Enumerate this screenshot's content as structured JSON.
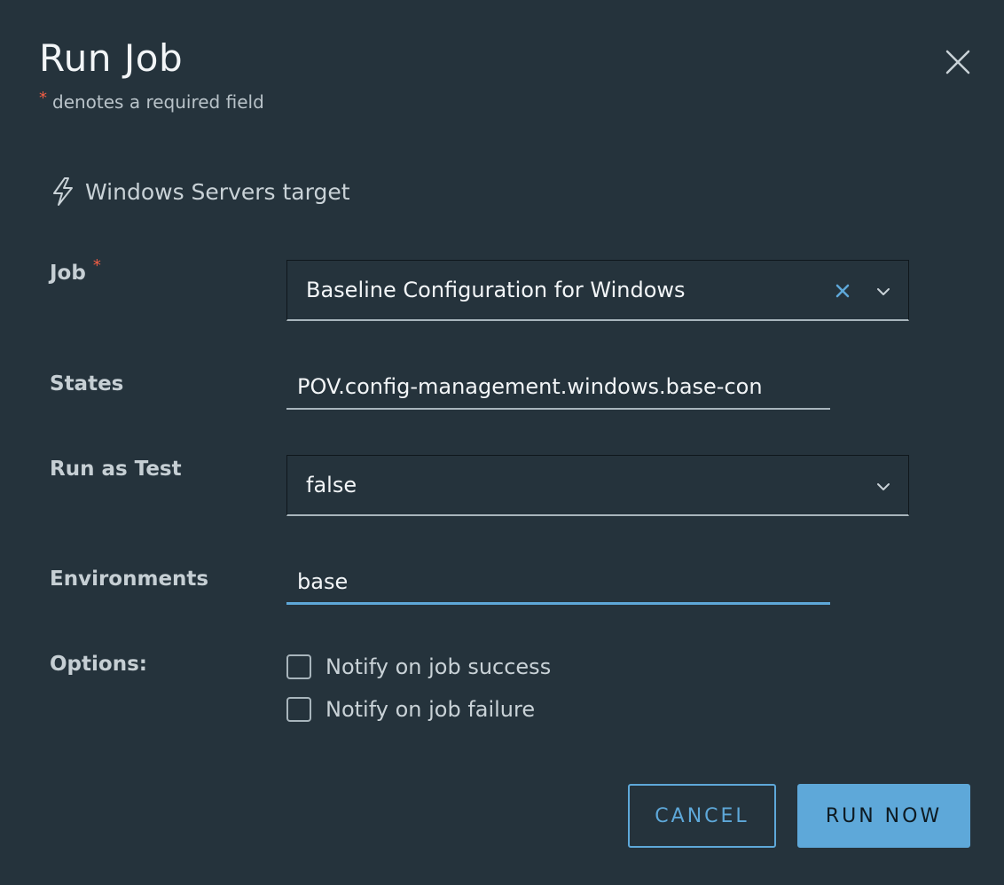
{
  "dialog": {
    "title": "Run Job",
    "required_marker": "*",
    "required_note": "denotes a required field",
    "close_icon": "close-icon"
  },
  "target": {
    "icon": "lightning-bolt-icon",
    "text": "Windows Servers target"
  },
  "form": {
    "job": {
      "label": "Job",
      "required_marker": "*",
      "value": "Baseline Configuration for Windows",
      "clear_icon": "clear-x-icon",
      "dropdown_icon": "chevron-down-icon"
    },
    "states": {
      "label": "States",
      "value": "POV.config-management.windows.base-con"
    },
    "run_as_test": {
      "label": "Run as Test",
      "value": "false",
      "dropdown_icon": "chevron-down-icon"
    },
    "environments": {
      "label": "Environments",
      "value": "base"
    },
    "options": {
      "label": "Options:",
      "items": [
        {
          "label": "Notify on job success",
          "checked": false
        },
        {
          "label": "Notify on job failure",
          "checked": false
        }
      ]
    }
  },
  "actions": {
    "cancel_label": "CANCEL",
    "run_label": "RUN NOW"
  },
  "colors": {
    "background": "#25333c",
    "accent": "#5ea8d9",
    "required": "#f35e44"
  }
}
